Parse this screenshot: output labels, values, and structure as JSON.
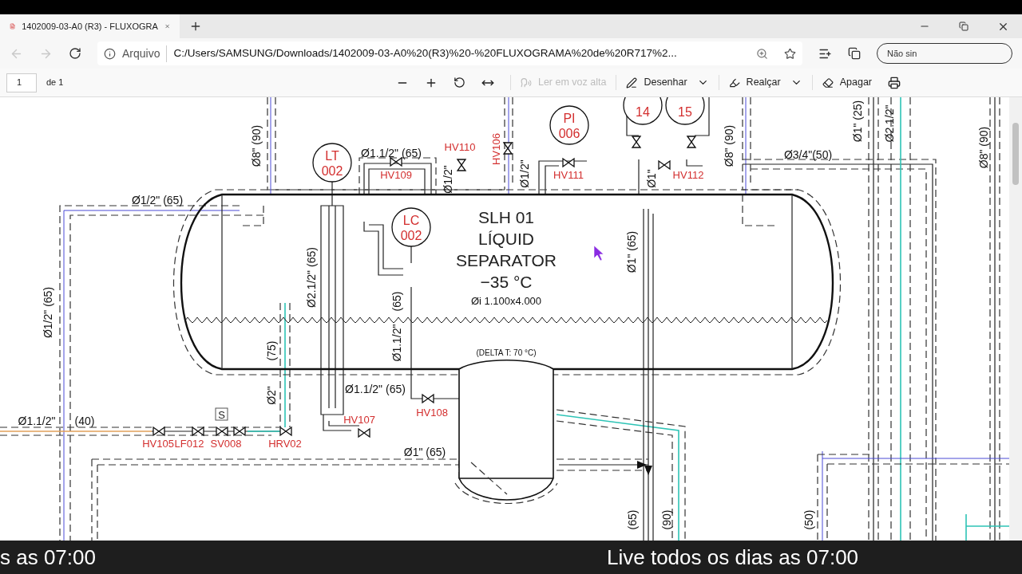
{
  "browser": {
    "tabs": [
      {
        "title": "1402009-03-A0 (R3) - FLUXOGRA",
        "selected": true
      }
    ],
    "address_bar": {
      "site_label": "Arquivo",
      "url": "C:/Users/SAMSUNG/Downloads/1402009-03-A0%20(R3)%20-%20FLUXOGRAMA%20de%20R717%2..."
    },
    "profile_button": "Não sin"
  },
  "pdf_toolbar": {
    "page": "1",
    "page_count": "de 1",
    "tools": [
      {
        "label": "Ler em voz alta",
        "kind": "read",
        "disabled": true,
        "has_menu": false
      },
      {
        "label": "Desenhar",
        "kind": "draw",
        "disabled": false,
        "has_menu": true
      },
      {
        "label": "Realçar",
        "kind": "highlight",
        "disabled": false,
        "has_menu": true
      },
      {
        "label": "Apagar",
        "kind": "erase",
        "disabled": false,
        "has_menu": false
      }
    ]
  },
  "drawing": {
    "vessel": {
      "lines": [
        "SLH 01",
        "LÍQUID",
        "SEPARATOR",
        "−35 °C"
      ],
      "size": "Øi 1.100x4.000"
    },
    "drum_note": "(DELTA T: 70 °C)",
    "instruments": [
      {
        "lines": [
          "LT",
          "002"
        ]
      },
      {
        "lines": [
          "LC",
          "002"
        ]
      },
      {
        "lines": [
          "PI",
          "006"
        ]
      },
      {
        "lines": [
          "14"
        ]
      },
      {
        "lines": [
          "15"
        ]
      }
    ],
    "solenoid_mark": "S",
    "labels": [
      {
        "text": "Ø8\" (90)",
        "kind": "dimension"
      },
      {
        "text": "Ø1.1/2\" (65)",
        "kind": "dimension"
      },
      {
        "text": "HV110",
        "kind": "tag"
      },
      {
        "text": "HV106",
        "kind": "tag"
      },
      {
        "text": "HV109",
        "kind": "tag"
      },
      {
        "text": "Ø1/2\"",
        "kind": "dimension"
      },
      {
        "text": "Ø1/2\"",
        "kind": "dimension"
      },
      {
        "text": "HV111",
        "kind": "tag"
      },
      {
        "text": "Ø1\"",
        "kind": "dimension"
      },
      {
        "text": "HV112",
        "kind": "tag"
      },
      {
        "text": "Ø8\" (90)",
        "kind": "dimension"
      },
      {
        "text": "Ø3/4\"(50)",
        "kind": "dimension"
      },
      {
        "text": "Ø1\" (25)",
        "kind": "dimension"
      },
      {
        "text": "Ø2.1/2\"",
        "kind": "dimension"
      },
      {
        "text": "Ø8\" (90)",
        "kind": "dimension"
      },
      {
        "text": "Ø1/2\" (65)",
        "kind": "dimension"
      },
      {
        "text": "Ø2.1/2\" (65)",
        "kind": "dimension"
      },
      {
        "text": "(65)",
        "kind": "dimension"
      },
      {
        "text": "Ø1.1/2\"",
        "kind": "dimension"
      },
      {
        "text": "Ø1\" (65)",
        "kind": "dimension"
      },
      {
        "text": "Ø1/2\" (65)",
        "kind": "dimension"
      },
      {
        "text": "(75)",
        "kind": "dimension"
      },
      {
        "text": "Ø2\"",
        "kind": "dimension"
      },
      {
        "text": "Ø1.1/2\" (65)",
        "kind": "dimension"
      },
      {
        "text": "Ø1.1/2\"",
        "kind": "dimension"
      },
      {
        "text": "(40)",
        "kind": "dimension"
      },
      {
        "text": "HV107",
        "kind": "tag"
      },
      {
        "text": "HV108",
        "kind": "tag"
      },
      {
        "text": "HV105",
        "kind": "tag"
      },
      {
        "text": "LF012",
        "kind": "tag"
      },
      {
        "text": "SV008",
        "kind": "tag"
      },
      {
        "text": "HRV02",
        "kind": "tag"
      },
      {
        "text": "Ø1\" (65)",
        "kind": "dimension"
      },
      {
        "text": "(65)",
        "kind": "dimension"
      },
      {
        "text": "(90)",
        "kind": "dimension"
      },
      {
        "text": "(50)",
        "kind": "dimension"
      }
    ]
  },
  "ticker": [
    "s as 07:00",
    "Live todos os dias as 07:00"
  ]
}
